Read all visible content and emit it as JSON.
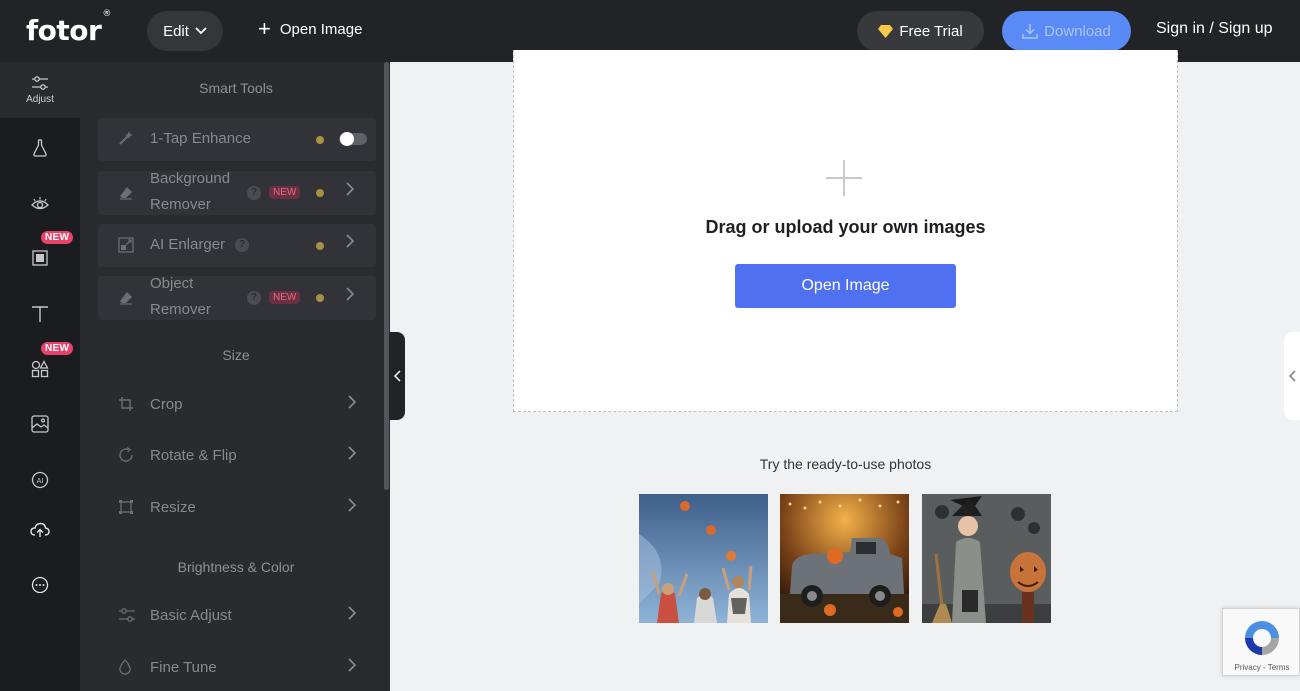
{
  "topbar": {
    "logo_text": "fotor",
    "logo_reg": "®",
    "edit_label": "Edit",
    "open_image_label": "Open Image",
    "free_trial_label": "Free Trial",
    "download_label": "Download",
    "signin_label": "Sign in / Sign up"
  },
  "rail": {
    "adjust_label": "Adjust",
    "new_badge": "NEW"
  },
  "panel": {
    "smart_tools_title": "Smart Tools",
    "size_title": "Size",
    "brightness_title": "Brightness & Color",
    "tools": {
      "one_tap": "1-Tap Enhance",
      "bg_remover_line1": "Background",
      "bg_remover_line2": "Remover",
      "ai_enlarger": "AI Enlarger",
      "object_remover_line1": "Object",
      "object_remover_line2": "Remover",
      "crop": "Crop",
      "rotate": "Rotate & Flip",
      "resize": "Resize",
      "basic_adjust": "Basic Adjust",
      "fine_tune": "Fine Tune"
    },
    "new_tag": "NEW"
  },
  "canvas": {
    "drag_text": "Drag or upload your own images",
    "open_button": "Open Image",
    "try_text": "Try the ready-to-use photos"
  },
  "recaptcha": {
    "privacy_terms": "Privacy - Terms"
  },
  "colors": {
    "topbar_bg": "#222326",
    "accent_blue": "#4f70f0",
    "download_blue": "#5a8af5",
    "new_pink": "#e8426b"
  }
}
